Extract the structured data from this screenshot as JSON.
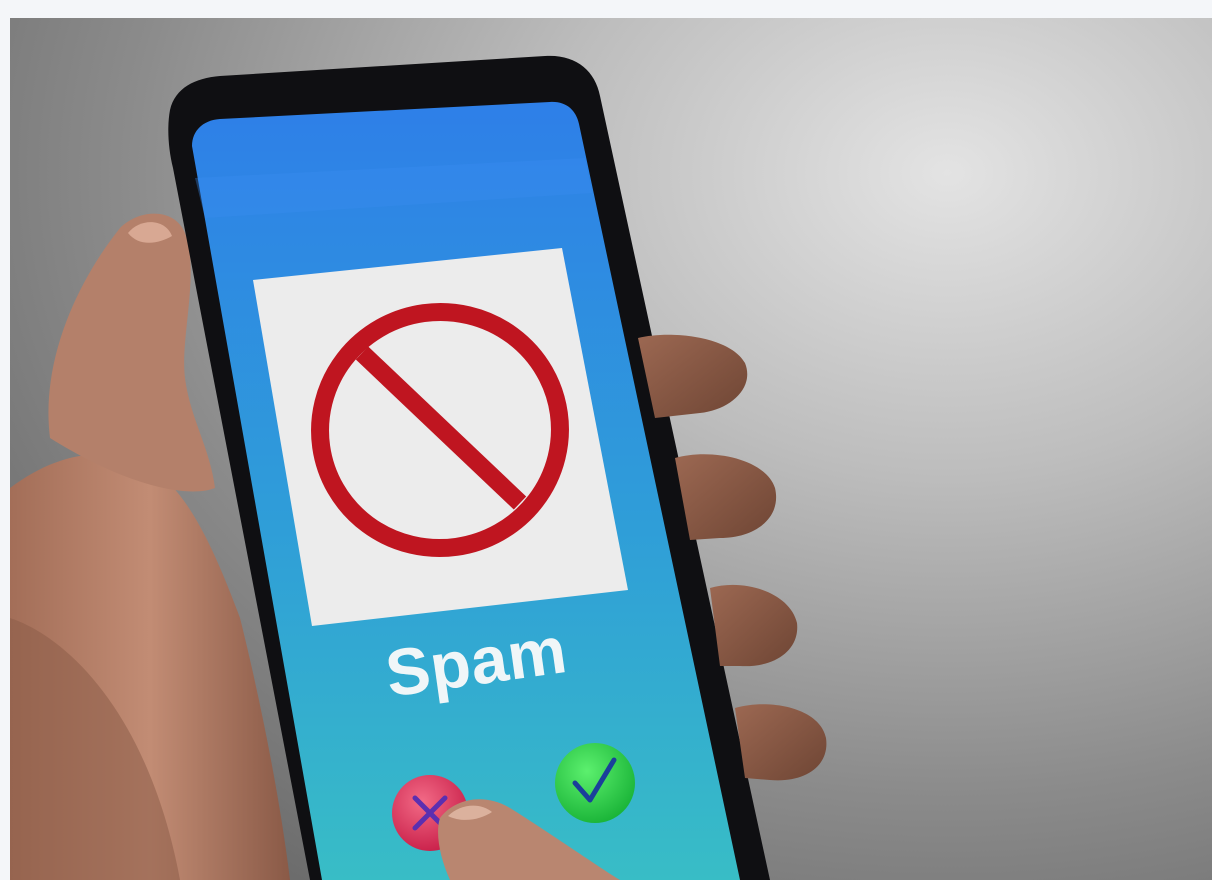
{
  "photo": {
    "description_alt": "",
    "screen_label": "Spam",
    "icons": {
      "prohibited": "prohibited-sign-icon",
      "decline": "decline-call-icon",
      "accept": "accept-check-icon"
    },
    "colors": {
      "background": "#8b8b8b",
      "screen_top": "#2f86ea",
      "screen_bottom": "#33b6c8",
      "prohibited_red": "#c0161e",
      "accept_green": "#2fd44a",
      "decline_red": "#e0355a",
      "skin": "#b58068"
    }
  }
}
